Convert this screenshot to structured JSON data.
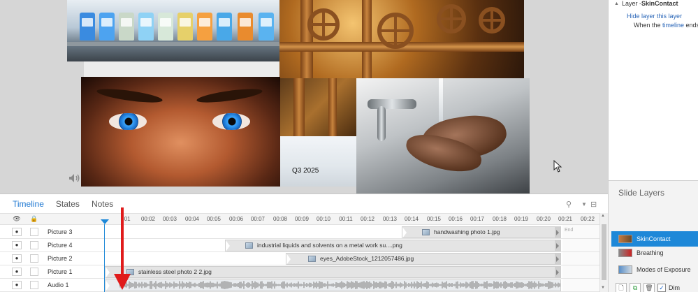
{
  "stage": {
    "q3_label": "Q3 2025"
  },
  "triggers_panel": {
    "layer_heading_prefix": "Layer - ",
    "layer_name": "SkinContact",
    "action_link": "Hide layer",
    "action_target": "this layer",
    "condition_prefix": "When the ",
    "condition_link": "timeline",
    "condition_suffix": " ends on"
  },
  "slide_layers": {
    "title": "Slide Layers",
    "items": [
      {
        "name": "SkinContact",
        "selected": true
      },
      {
        "name": "Breathing",
        "selected": false
      },
      {
        "name": "Modes of Exposure",
        "selected": false
      }
    ],
    "dim_label": "Dim"
  },
  "timeline": {
    "tabs": [
      {
        "label": "Timeline",
        "active": true
      },
      {
        "label": "States",
        "active": false
      },
      {
        "label": "Notes",
        "active": false
      }
    ],
    "ruler": [
      "00:01",
      "00:02",
      "00:03",
      "00:04",
      "00:05",
      "00:06",
      "00:07",
      "00:08",
      "00:09",
      "00:10",
      "00:11",
      "00:12",
      "00:13",
      "00:14",
      "00:15",
      "00:16",
      "00:17",
      "00:18",
      "00:19",
      "00:20",
      "00:21",
      "00:22"
    ],
    "ruler_first_label": ":01",
    "end_label": "End",
    "tracks": [
      {
        "name": "Picture 3",
        "clip": "handwashing photo 1.jpg"
      },
      {
        "name": "Picture 4",
        "clip": "industrial liquids and solvents on a metal work su....png"
      },
      {
        "name": "Picture 2",
        "clip": "eyes_AdobeStock_1212057486.jpg"
      },
      {
        "name": "Picture 1",
        "clip": "stainless steel photo 2 2.jpg"
      },
      {
        "name": "Audio 1",
        "clip": ""
      }
    ]
  }
}
